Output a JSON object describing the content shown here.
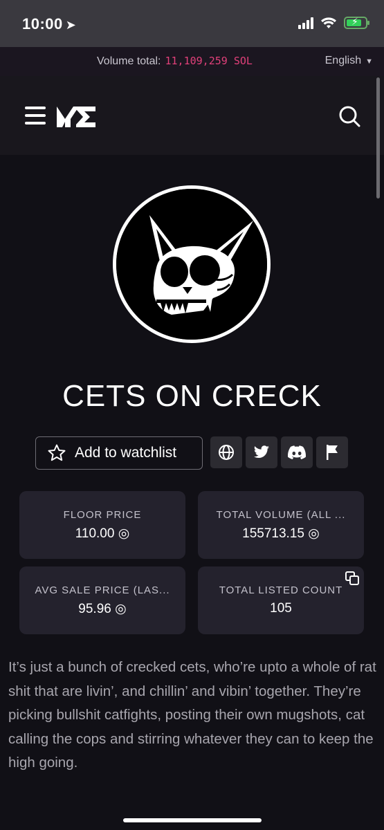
{
  "status_bar": {
    "time": "10:00"
  },
  "top_strip": {
    "volume_label": "Volume total:",
    "volume_value": "11,109,259 SOL",
    "language": "English"
  },
  "header": {
    "logo": "ME",
    "menu_icon": "hamburger-icon",
    "search_icon": "search-icon"
  },
  "collection": {
    "name": "CETS ON CRECK",
    "watchlist_label": "Add to watchlist",
    "social_icons": [
      "globe-icon",
      "twitter-icon",
      "discord-icon",
      "flag-icon"
    ],
    "stats": [
      {
        "label": "FLOOR PRICE",
        "value": "110.00 ◎"
      },
      {
        "label": "TOTAL VOLUME (ALL ...",
        "value": "155713.15 ◎"
      },
      {
        "label": "AVG SALE PRICE (LAS...",
        "value": "95.96 ◎"
      },
      {
        "label": "TOTAL LISTED COUNT",
        "value": "105"
      }
    ],
    "description": "It’s just a bunch of crecked cets, who’re upto a whole of rat shit that are livin’, and chillin’ and vibin’ together. They’re picking bullshit catfights, posting their own mugshots, cat calling the cops and stirring whatever they can to keep the high going."
  },
  "colors": {
    "accent": "#e2407a",
    "background": "#111016",
    "card": "#24222d"
  }
}
